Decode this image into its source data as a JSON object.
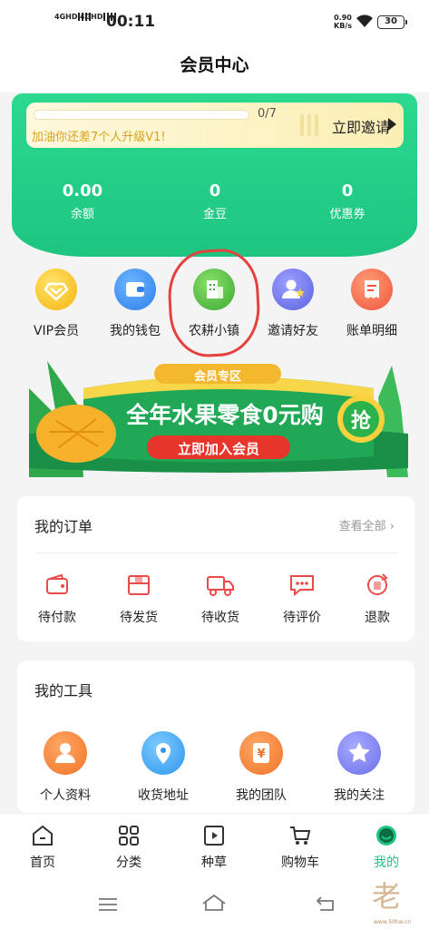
{
  "status_bar": {
    "signal1": "4GHD",
    "signal2": "4GHD",
    "time": "00:11",
    "speed_value": "0.90",
    "speed_unit": "KB/s",
    "battery": "30"
  },
  "header": {
    "title": "会员中心"
  },
  "member_card": {
    "progress_text": "0/7",
    "progress_fraction": 0,
    "upgrade_hint": "加油你还差7个人升级V1!",
    "invite_label": "立即邀请",
    "stats": [
      {
        "value": "0.00",
        "label": "余额"
      },
      {
        "value": "0",
        "label": "金豆"
      },
      {
        "value": "0",
        "label": "优惠券"
      }
    ]
  },
  "quick_menu": [
    {
      "label": "VIP会员",
      "icon": "vip-diamond-icon",
      "color": "#f7c51a"
    },
    {
      "label": "我的钱包",
      "icon": "wallet-icon",
      "color": "#3a8cf6"
    },
    {
      "label": "农耕小镇",
      "icon": "building-icon",
      "color": "#4cbb3d"
    },
    {
      "label": "邀请好友",
      "icon": "invite-user-icon",
      "color": "#6b73ea"
    },
    {
      "label": "账单明细",
      "icon": "bill-icon",
      "color": "#f46a4a"
    }
  ],
  "promo": {
    "tag": "会员专区",
    "headline": "全年水果零食0元购",
    "button": "立即加入会员",
    "badge": "抢"
  },
  "orders": {
    "title": "我的订单",
    "view_all": "查看全部",
    "items": [
      {
        "label": "待付款",
        "icon": "wallet-icon"
      },
      {
        "label": "待发货",
        "icon": "package-icon"
      },
      {
        "label": "待收货",
        "icon": "truck-icon"
      },
      {
        "label": "待评价",
        "icon": "comment-icon"
      },
      {
        "label": "退款",
        "icon": "refund-icon"
      }
    ]
  },
  "tools": {
    "title": "我的工具",
    "items": [
      {
        "label": "个人资料",
        "icon": "profile-icon",
        "color": "#f3813c"
      },
      {
        "label": "收货地址",
        "icon": "location-icon",
        "color": "#3aa6f3"
      },
      {
        "label": "我的团队",
        "icon": "yen-icon",
        "color": "#f3813c"
      },
      {
        "label": "我的关注",
        "icon": "star-icon",
        "color": "#7c7ff2"
      }
    ]
  },
  "bottom_nav": [
    {
      "label": "首页",
      "icon": "home-icon",
      "active": false
    },
    {
      "label": "分类",
      "icon": "category-icon",
      "active": false
    },
    {
      "label": "种草",
      "icon": "play-icon",
      "active": false
    },
    {
      "label": "购物车",
      "icon": "cart-icon",
      "active": false
    },
    {
      "label": "我的",
      "icon": "profile-smile-icon",
      "active": true
    }
  ],
  "colors": {
    "accent": "#1ec582",
    "order_icon": "#ea4a4a",
    "annotation": "#e5413f"
  },
  "watermark": {
    "glyph": "老",
    "url": "www.5ithw.cn"
  }
}
